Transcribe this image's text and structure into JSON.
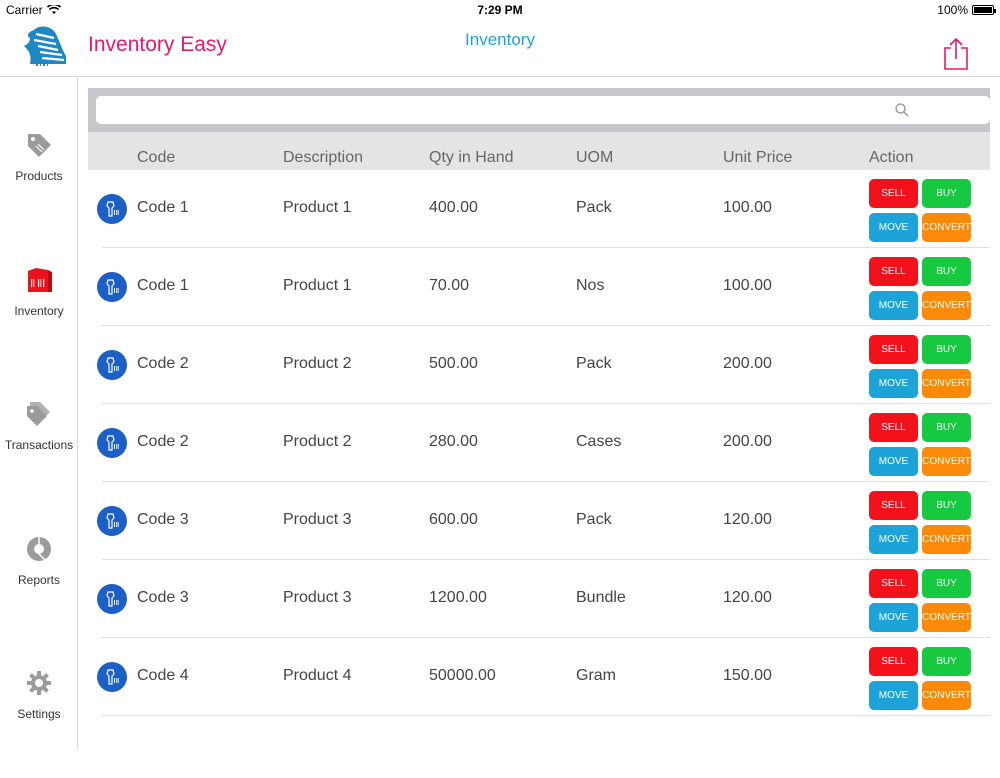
{
  "status": {
    "carrier": "Carrier",
    "time": "7:29 PM",
    "battery": "100%"
  },
  "header": {
    "app_title": "Inventory Easy",
    "title": "Inventory",
    "share_icon": "share-icon"
  },
  "sidebar": {
    "items": [
      {
        "label": "Products",
        "icon": "price-tag-icon",
        "active": false
      },
      {
        "label": "Inventory",
        "icon": "inventory-icon",
        "active": true
      },
      {
        "label": "Transactions",
        "icon": "tags-icon",
        "active": false
      },
      {
        "label": "Reports",
        "icon": "pie-chart-icon",
        "active": false
      },
      {
        "label": "Settings",
        "icon": "gear-icon",
        "active": false
      }
    ]
  },
  "search": {
    "placeholder": ""
  },
  "table": {
    "columns": [
      "Code",
      "Description",
      "Qty in Hand",
      "UOM",
      "Unit Price",
      "Action"
    ],
    "actions": {
      "sell": "SELL",
      "buy": "BUY",
      "move": "MOVE",
      "convert": "CONVERT"
    },
    "rows": [
      {
        "code": "Code 1",
        "description": "Product 1",
        "qty": "400.00",
        "uom": "Pack",
        "price": "100.00"
      },
      {
        "code": "Code 1",
        "description": "Product 1",
        "qty": "70.00",
        "uom": "Nos",
        "price": "100.00"
      },
      {
        "code": "Code 2",
        "description": "Product 2",
        "qty": "500.00",
        "uom": "Pack",
        "price": "200.00"
      },
      {
        "code": "Code 2",
        "description": "Product 2",
        "qty": "280.00",
        "uom": "Cases",
        "price": "200.00"
      },
      {
        "code": "Code 3",
        "description": "Product 3",
        "qty": "600.00",
        "uom": "Pack",
        "price": "120.00"
      },
      {
        "code": "Code 3",
        "description": "Product 3",
        "qty": "1200.00",
        "uom": "Bundle",
        "price": "120.00"
      },
      {
        "code": "Code 4",
        "description": "Product 4",
        "qty": "50000.00",
        "uom": "Gram",
        "price": "150.00"
      }
    ]
  },
  "colors": {
    "brand": "#e6196e",
    "accent": "#1ea3d8",
    "sell": "#f3111b",
    "buy": "#17c940",
    "move": "#1ea3d8",
    "convert": "#fa8a07"
  }
}
